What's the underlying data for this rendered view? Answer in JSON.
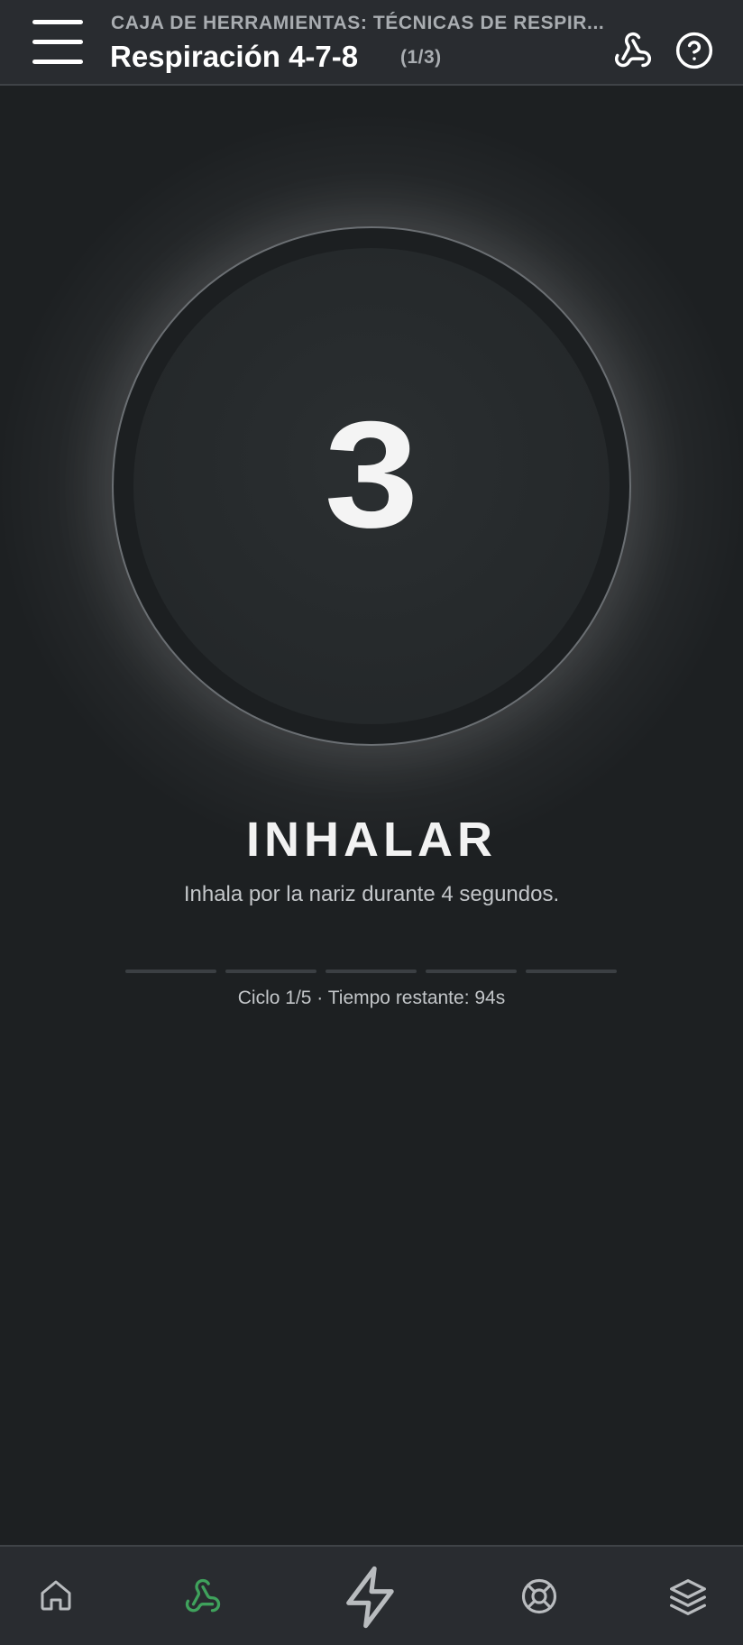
{
  "header": {
    "subtitle": "CAJA DE HERRAMIENTAS: TÉCNICAS DE RESPIR...",
    "title": "Respiración 4-7-8",
    "counter": "(1/3)",
    "icons": [
      "menu-icon",
      "webhook-icon",
      "help-circle-icon"
    ]
  },
  "exercise": {
    "countdown": "3",
    "phase": "INHALAR",
    "instruction": "Inhala por la nariz durante 4 segundos.",
    "cycle_segments": 5,
    "cycle_progress": [
      0,
      0,
      0,
      0,
      0
    ],
    "status": "Ciclo 1/5 · Tiempo restante: 94s"
  },
  "bottom_nav": {
    "items": [
      {
        "icon": "home-icon",
        "active": false
      },
      {
        "icon": "webhook-icon",
        "active": true
      },
      {
        "icon": "lightning-icon",
        "active": false
      },
      {
        "icon": "lifebuoy-icon",
        "active": false
      },
      {
        "icon": "layers-icon",
        "active": false
      }
    ]
  },
  "colors": {
    "background": "#1d2022",
    "bar": "#292c30",
    "accent_green": "#3fa25c",
    "text_muted": "#a9adb1"
  }
}
